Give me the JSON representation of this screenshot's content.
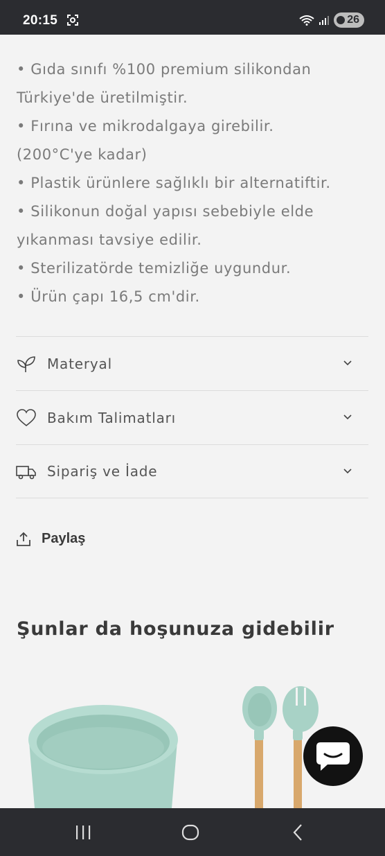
{
  "status_bar": {
    "time": "20:15",
    "battery": "26",
    "icons": [
      "screenshot-icon",
      "wifi-icon",
      "signal-icon",
      "battery-icon"
    ]
  },
  "description": {
    "lines": [
      "• Gıda sınıfı %100 premium silikondan",
      "Türkiye'de üretilmiştir.",
      "• Fırına ve mikrodalgaya girebilir.",
      "(200°C'ye kadar)",
      "• Plastik ürünlere sağlıklı bir alternatiftir.",
      "• Silikonun doğal yapısı sebebiyle elde",
      "yıkanması tavsiye edilir.",
      "• Sterilizatörde temizliğe uygundur.",
      "• Ürün çapı 16,5 cm'dir."
    ]
  },
  "accordion": [
    {
      "label": "Materyal",
      "icon": "leaf-icon"
    },
    {
      "label": "Bakım Talimatları",
      "icon": "heart-icon"
    },
    {
      "label": "Sipariş ve İade",
      "icon": "truck-icon"
    }
  ],
  "share": {
    "label": "Paylaş",
    "icon": "share-icon"
  },
  "recommendations": {
    "title": "Şunlar da hoşunuza gidebilir"
  },
  "colors": {
    "background": "#f3f3f3",
    "product_mint": "#a8d2c6",
    "bamboo": "#d8a86c",
    "system_bar": "#2b2c30"
  },
  "nav_bar": {
    "icons": [
      "recent-apps-icon",
      "home-icon",
      "back-icon"
    ]
  }
}
